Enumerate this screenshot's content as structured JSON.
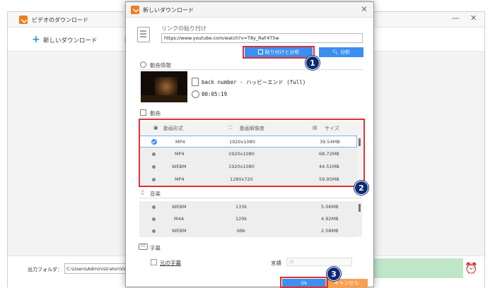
{
  "main_window": {
    "title": "ビデオのダウンロード",
    "min_symbol": "—",
    "close_symbol": "✕",
    "new_download_label": "新しいダウンロード",
    "output_folder_label": "出力フォルダ：",
    "output_path": "C:\\Users\\Administrator\\Videos\\",
    "alarm_icon": "alarm-clock-icon"
  },
  "dialog": {
    "title": "新しいダウンロード",
    "close_symbol": "✕",
    "link_label": "リンクの貼り付け",
    "url_value": "https://www.youtube.com/watch?v=T8y_RaF4T5w",
    "paste_analyze_label": "貼り付けと分析",
    "analyze_label": "分析",
    "video_info_label": "動画情報",
    "video_title": "back number - ハッピーエンド (full)",
    "video_duration": "00:05:19",
    "video_section_label": "動画",
    "video_headers": [
      "動画形式",
      "動画解像度",
      "サイズ"
    ],
    "video_rows": [
      {
        "format": "MP4",
        "resolution": "1920x1080",
        "size": "39.54MB",
        "selected": true
      },
      {
        "format": "MP4",
        "resolution": "1920x1080",
        "size": "68.72MB",
        "selected": false
      },
      {
        "format": "WEBM",
        "resolution": "1920x1080",
        "size": "44.51MB",
        "selected": false
      },
      {
        "format": "MP4",
        "resolution": "1280x720",
        "size": "59.95MB",
        "selected": false
      }
    ],
    "audio_section_label": "音楽",
    "audio_rows": [
      {
        "format": "WEBM",
        "bitrate": "133k",
        "size": "5.06MB"
      },
      {
        "format": "M4A",
        "bitrate": "129k",
        "size": "4.92MB"
      },
      {
        "format": "WEBM",
        "bitrate": "68k",
        "size": "2.58MB"
      }
    ],
    "subtitle_section_label": "字幕",
    "cc_text": "CC",
    "original_subtitle_label": "元の字幕",
    "language_label": "言語",
    "language_value": "zh",
    "ok_label": "Ok",
    "cancel_label": "キャンセル"
  },
  "annotations": {
    "badge_1": "1",
    "badge_2": "2",
    "badge_3": "3",
    "highlight_color": "#e03030",
    "badge_color": "#0d2a72"
  },
  "colors": {
    "accent_blue": "#3b8ff0",
    "cancel_orange": "#f5a052",
    "app_orange": "#f07b1e"
  }
}
